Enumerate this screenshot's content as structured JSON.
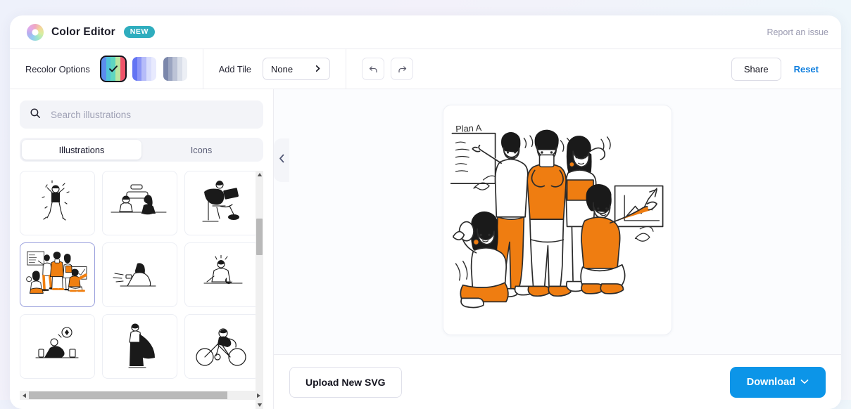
{
  "header": {
    "logo_icon": "color-wheel-icon",
    "title": "Color Editor",
    "badge": "NEW",
    "report_link": "Report an issue"
  },
  "toolbar": {
    "recolor_label": "Recolor Options",
    "palettes": [
      {
        "name": "palette-vivid",
        "selected": true,
        "colors": [
          "#5b8def",
          "#4fc3d9",
          "#5fd6c0",
          "#b9e6a0",
          "#f0536a"
        ]
      },
      {
        "name": "palette-indigo",
        "selected": false,
        "colors": [
          "#6374f3",
          "#8b95f6",
          "#b6bcf9",
          "#d9ddfc",
          "#e8eafe"
        ]
      },
      {
        "name": "palette-slate",
        "selected": false,
        "colors": [
          "#7b87ab",
          "#9aa4c0",
          "#bcc3d6",
          "#dadfe9",
          "#eceff5"
        ]
      }
    ],
    "add_tile_label": "Add Tile",
    "add_tile_value": "None",
    "add_tile_options": [
      "None"
    ],
    "undo_icon": "undo-arrow-icon",
    "redo_icon": "redo-arrow-icon",
    "share_label": "Share",
    "reset_label": "Reset",
    "reset_color": "#0f7ede"
  },
  "sidebar": {
    "search": {
      "icon": "search-icon",
      "placeholder": "Search illustrations",
      "value": ""
    },
    "tabs": [
      {
        "label": "Illustrations",
        "active": true
      },
      {
        "label": "Icons",
        "active": false
      }
    ],
    "thumbnails": [
      {
        "name": "thumb-celebrating-person",
        "selected": false
      },
      {
        "name": "thumb-two-people-desk",
        "selected": false
      },
      {
        "name": "thumb-person-laptop-chair",
        "selected": false
      },
      {
        "name": "thumb-team-plan-a",
        "selected": true
      },
      {
        "name": "thumb-person-lying-phone",
        "selected": false
      },
      {
        "name": "thumb-person-sitting-dog",
        "selected": false
      },
      {
        "name": "thumb-person-picnic",
        "selected": false
      },
      {
        "name": "thumb-person-cape",
        "selected": false
      },
      {
        "name": "thumb-person-cycling",
        "selected": false
      }
    ],
    "scroll": {
      "up_arrow_icon": "caret-up-icon",
      "down_arrow_icon": "caret-down-icon",
      "left_arrow_icon": "caret-left-icon",
      "right_arrow_icon": "caret-right-icon"
    },
    "collapse_icon": "chevron-left-icon"
  },
  "canvas": {
    "artwork_name": "team-plan-a-illustration",
    "artwork_caption": "Plan A",
    "accent_color": "#f07f10"
  },
  "footer": {
    "upload_label": "Upload New SVG",
    "download_label": "Download",
    "download_caret": "chevron-down-icon",
    "download_color": "#0c95e8"
  }
}
